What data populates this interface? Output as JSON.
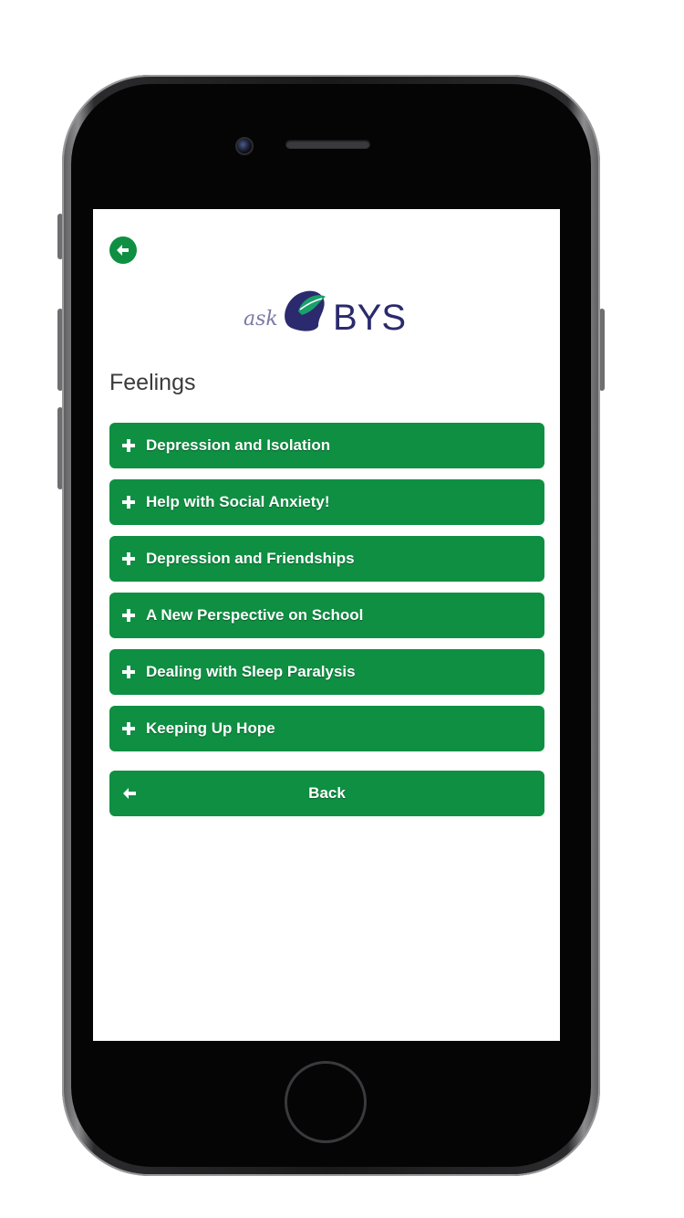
{
  "app": {
    "logo": {
      "prefix": "ask",
      "brand": "BYS"
    },
    "accent_color": "#0e8f42",
    "page_title": "Feelings",
    "topics": [
      {
        "label": "Depression and Isolation",
        "icon": "plus-icon"
      },
      {
        "label": "Help with Social Anxiety!",
        "icon": "plus-icon"
      },
      {
        "label": "Depression and Friendships",
        "icon": "plus-icon"
      },
      {
        "label": "A New Perspective on School",
        "icon": "plus-icon"
      },
      {
        "label": "Dealing with Sleep Paralysis",
        "icon": "plus-icon"
      },
      {
        "label": "Keeping Up Hope",
        "icon": "plus-icon"
      }
    ],
    "back_button": {
      "label": "Back",
      "icon": "arrow-left-icon"
    },
    "top_back_icon": "arrow-left-circle-icon"
  }
}
